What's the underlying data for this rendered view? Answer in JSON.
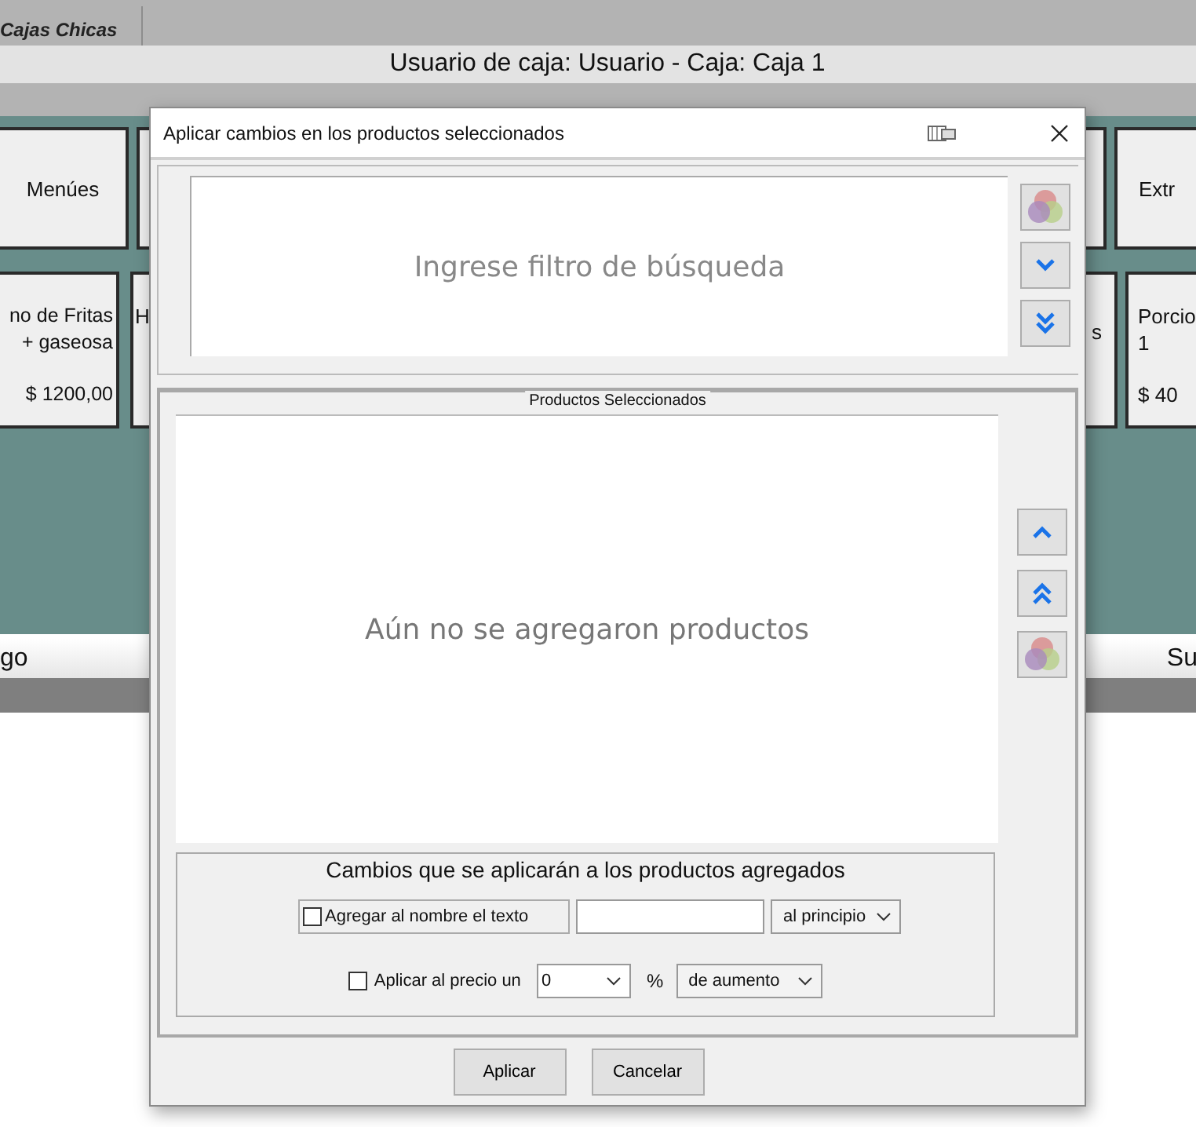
{
  "app": {
    "tab": "Cajas Chicas",
    "header": "Usuario de caja: Usuario - Caja: Caja 1",
    "row_1": {
      "left": [
        {
          "lines": [
            "Menúes"
          ]
        }
      ],
      "right": [
        {
          "lines": [
            "Extr"
          ]
        }
      ]
    },
    "row_2": {
      "left": [
        {
          "lines": [
            "no de Fritas",
            "+ gaseosa"
          ],
          "price": "$ 1200,00"
        },
        {
          "lines": [
            "H"
          ]
        }
      ],
      "right": [
        {
          "lines": [
            "s"
          ]
        },
        {
          "lines": [
            "Porcio",
            "1"
          ],
          "price": "$ 40"
        }
      ]
    },
    "footer_left": "go",
    "footer_right": "Su"
  },
  "dialog": {
    "title": "Aplicar cambios en los productos seleccionados",
    "search": {
      "placeholder": "Ingrese filtro de búsqueda"
    },
    "selected_group": {
      "title": "Productos Seleccionados",
      "empty_text": "Aún no se agregaron productos"
    },
    "changes": {
      "title": "Cambios que se aplicarán a los productos agregados",
      "name_option": {
        "label": "Agregar al nombre el texto",
        "checked": false,
        "position": "al principio"
      },
      "price_option": {
        "label": "Aplicar al precio un",
        "checked": false,
        "amount": "0",
        "unit": "%",
        "direction": "de aumento"
      }
    },
    "buttons": [
      "Aplicar",
      "Cancelar"
    ]
  }
}
